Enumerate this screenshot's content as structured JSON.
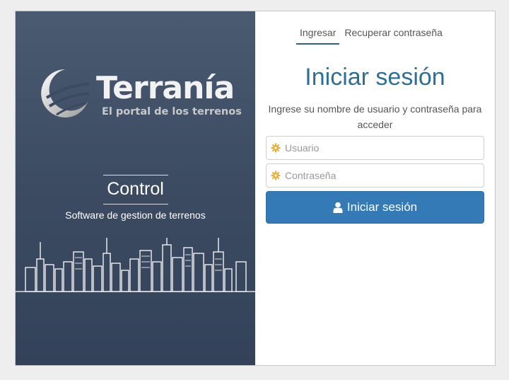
{
  "brand": {
    "name": "Terranía",
    "tagline": "El portal de los terrenos"
  },
  "left_panel": {
    "title": "Control",
    "subtitle": "Software de gestion de terrenos"
  },
  "tabs": [
    {
      "label": "Ingresar",
      "active": true
    },
    {
      "label": "Recuperar contraseña",
      "active": false
    }
  ],
  "login": {
    "title": "Iniciar sesión",
    "instructions": "Ingrese su nombre de usuario y contraseña para acceder",
    "username_placeholder": "Usuario",
    "password_placeholder": "Contraseña",
    "submit_label": "Iniciar sesión"
  },
  "colors": {
    "panel_bg": "#3c4b61",
    "accent": "#337ab7",
    "title": "#2f6f95",
    "field_icon": "#e8b23a"
  },
  "icons": {
    "field": "gear-icon",
    "submit": "user-icon"
  }
}
